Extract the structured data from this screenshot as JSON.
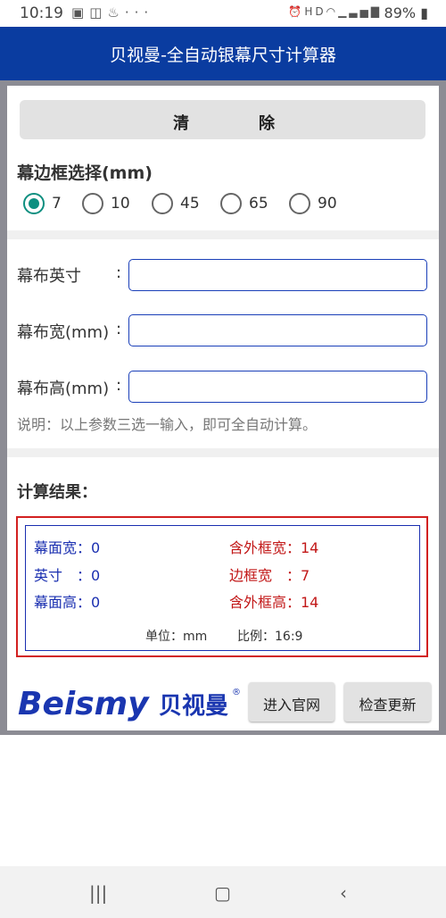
{
  "status_bar": {
    "time": "10:19",
    "left_icons": [
      "image-icon",
      "voicemail-icon",
      "notification-icon",
      "more-icon"
    ],
    "battery": "89%"
  },
  "app": {
    "title": "贝视曼-全自动银幕尺寸计算器"
  },
  "clear_button": {
    "char1": "清",
    "char2": "除"
  },
  "frame_select": {
    "title": "幕边框选择(mm)",
    "options": [
      "7",
      "10",
      "45",
      "65",
      "90"
    ],
    "selected": "7"
  },
  "fields": [
    {
      "label": "幕布英寸",
      "colon": ":",
      "value": ""
    },
    {
      "label": "幕布宽(mm)",
      "colon": ":",
      "value": ""
    },
    {
      "label": "幕布高(mm)",
      "colon": ":",
      "value": ""
    }
  ],
  "note": "说明：以上参数三选一输入，即可全自动计算。",
  "results": {
    "title": "计算结果：",
    "screen_width": "幕面宽：0",
    "inch": "英寸　：0",
    "screen_height": "幕面高：0",
    "outer_width": "含外框宽：14",
    "border_width": "边框宽　：7",
    "outer_height": "含外框高：14",
    "unit": "单位：mm",
    "ratio": "比例：16:9"
  },
  "logo": {
    "brand": "Beismy",
    "cn": "贝视曼",
    "mark": "®"
  },
  "buttons": {
    "website": "进入官网",
    "update": "检查更新"
  },
  "colors": {
    "header": "#0a3ca0",
    "radio_checked": "#0d8f80",
    "result_blue": "#1a2fb0",
    "result_red": "#c21818"
  }
}
